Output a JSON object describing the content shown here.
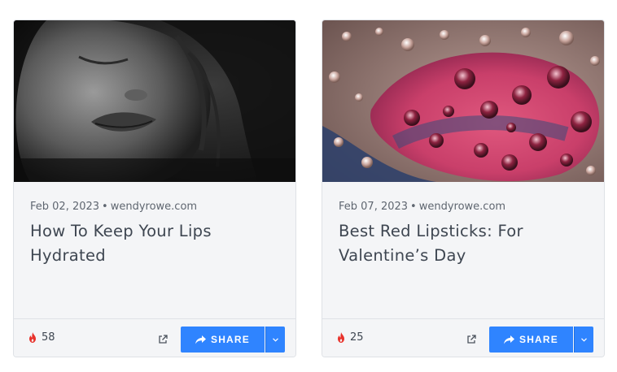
{
  "cards": [
    {
      "image_alt": "Black and white close-up portrait of a woman with eyes closed",
      "date": "Feb 02, 2023",
      "separator": "•",
      "source": "wendyrowe.com",
      "title": "How To Keep Your Lips Hydrated",
      "likes": "58",
      "share_label": "SHARE"
    },
    {
      "image_alt": "Close-up of red lips covered in water droplets",
      "date": "Feb 07, 2023",
      "separator": "•",
      "source": "wendyrowe.com",
      "title": "Best Red Lipsticks: For Valentine’s Day",
      "likes": "25",
      "share_label": "SHARE"
    }
  ],
  "colors": {
    "accent": "#2f84ff",
    "flame": "#e8322b",
    "card_bg": "#f4f5f7",
    "title_text": "#3e4651"
  },
  "icons": {
    "likes": "flame-icon",
    "external": "external-link-icon",
    "share": "share-arrow-icon",
    "dropdown": "chevron-down-icon"
  }
}
